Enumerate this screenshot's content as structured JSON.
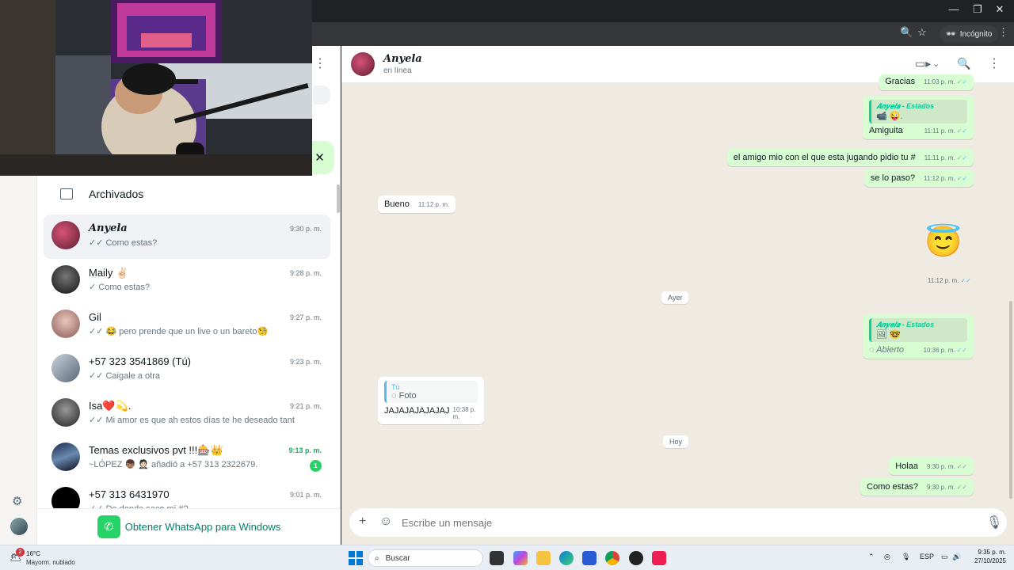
{
  "browser": {
    "incognito_label": "Incógnito",
    "zoom_icon": "zoom-icon",
    "star_icon": "star-icon"
  },
  "sidebar": {
    "archived_label": "Archivados",
    "chats": [
      {
        "name": "𝑨𝒏𝒚𝒆𝒍𝒂",
        "time": "9:30 p. m.",
        "preview": "✓✓ Como estas?",
        "selected": true,
        "unread": ""
      },
      {
        "name": "Maily ✌🏻",
        "time": "9:28 p. m.",
        "preview": "✓ Como estas?",
        "selected": false,
        "unread": ""
      },
      {
        "name": "Gil",
        "time": "9:27 p. m.",
        "preview": "✓✓ 😂 pero prende que un live o un bareto🧐",
        "selected": false,
        "unread": ""
      },
      {
        "name": "+57 323 3541869 (Tú)",
        "time": "9:23 p. m.",
        "preview": "✓✓ Caigale a otra",
        "selected": false,
        "unread": ""
      },
      {
        "name": "Isa❤️💫.",
        "time": "9:21 p. m.",
        "preview": "✓✓ Mi amor es que ah estos días te he deseado tanto...",
        "selected": false,
        "unread": ""
      },
      {
        "name": "Temas exclusivos pvt !!!🎰👑",
        "time": "9:13 p. m.",
        "preview": "~LÓPEZ 👦🏽 🤵🏻 añadió a +57 313 2322679.",
        "selected": false,
        "unread": "1"
      },
      {
        "name": "+57 313 6431970",
        "time": "9:01 p. m.",
        "preview": "✓✓ De donde saco mi #?",
        "selected": false,
        "unread": ""
      }
    ],
    "get_app_label": "Obtener WhatsApp para Windows"
  },
  "conversation": {
    "contact_name": "𝑨𝒏𝒚𝒆𝒍𝒂",
    "contact_status": "en línea",
    "messages": {
      "m0": {
        "text": "Gracias",
        "time": "11:03 p. m."
      },
      "m1": {
        "quote_name": "𝑨𝒏𝒚𝒆𝒍𝒂 - Estados",
        "quote_body": "📹 😜.",
        "text": "Amiguita",
        "time": "11:11 p. m."
      },
      "m2": {
        "text": "el amigo mio con el que esta jugando pidio tu #",
        "time": "11:11 p. m."
      },
      "m3": {
        "text": "se lo paso?",
        "time": "11:12 p. m."
      },
      "m4": {
        "text": "Bueno",
        "time": "11:12 p. m."
      },
      "m5": {
        "text": "😇",
        "time": "11:12 p. m."
      },
      "m6": {
        "quote_name": "𝑨𝒏𝒚𝒆𝒍𝒂 - Estados",
        "quote_body": "🖼 🤓",
        "text": "Abierto",
        "time": "10:36 p. m."
      },
      "m7": {
        "quote_name": "Tú",
        "quote_body": "Foto",
        "text": "JAJAJAJAJAJAJ",
        "time": "10:38 p. m."
      },
      "m8": {
        "text": "Holaa",
        "time": "9:30 p. m."
      },
      "m9": {
        "text": "Como estas?",
        "time": "9:30 p. m."
      }
    },
    "date_yesterday": "Ayer",
    "date_today": "Hoy",
    "composer_placeholder": "Escribe un mensaje"
  },
  "taskbar": {
    "weather_temp": "16°C",
    "weather_desc": "Mayorm. nublado",
    "weather_badge": "2",
    "search_label": "Buscar",
    "lang": "ESP",
    "time": "9:35 p. m.",
    "date": "27/10/2025"
  },
  "colors": {
    "accent_green": "#25d366",
    "chat_bg": "#efeae2",
    "outgoing_bubble": "#d9fdd3"
  }
}
